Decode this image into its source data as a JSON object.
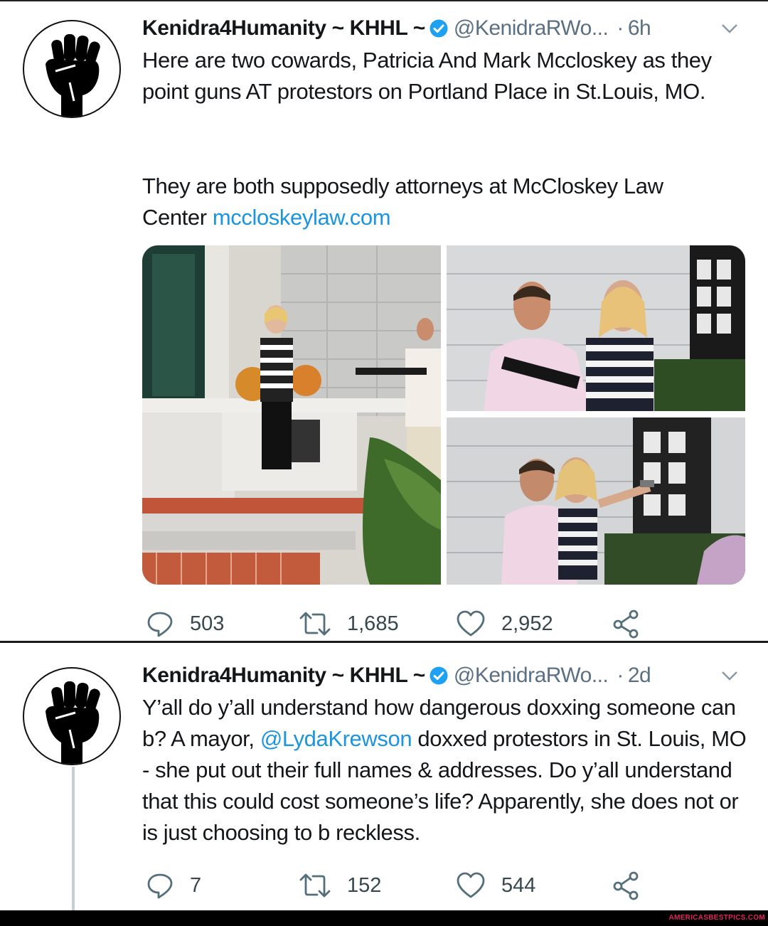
{
  "tweets": [
    {
      "display_name": "Kenidra4Humanity ~ KHHL ~",
      "handle": "@KenidraRWo...",
      "separator": "·",
      "time": "6h",
      "text_line1": "Here are two cowards, Patricia And Mark Mccloskey as they point guns AT protestors on Portland Place in St.Louis, MO.",
      "text_line2_prefix": "They are both supposedly attorneys at McCloskey Law Center ",
      "text_link": "mccloskeylaw.com",
      "replies": "503",
      "retweets": "1,685",
      "likes": "2,952"
    },
    {
      "display_name": "Kenidra4Humanity ~ KHHL ~",
      "handle": "@KenidraRWo...",
      "separator": "·",
      "time": "2d",
      "text_part1": "Y’all do y’all understand how dangerous doxxing someone can b? A mayor, ",
      "mention": "@LydaKrewson",
      "text_part2": " doxxed protestors in St. Louis, MO - she put out their full names & addresses. Do y’all understand that this could cost someone’s life? Apparently, she does not or is just choosing to b reckless.",
      "replies": "7",
      "retweets": "152",
      "likes": "544"
    }
  ],
  "watermark": "AMERICASBESTPICS.COM",
  "colors": {
    "link": "#1b95e0",
    "verified": "#1da1f2",
    "meta_gray": "#5b7083"
  },
  "icons": [
    "raised-fist-icon",
    "verified-badge-icon",
    "chevron-down-icon",
    "reply-icon",
    "retweet-icon",
    "like-icon",
    "share-icon"
  ]
}
